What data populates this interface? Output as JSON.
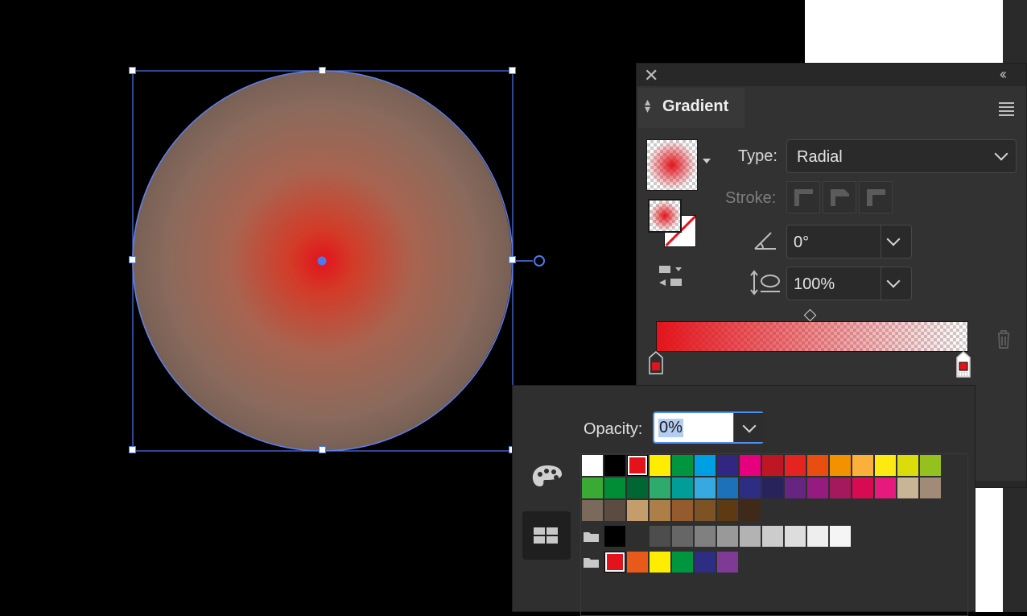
{
  "panel": {
    "title": "Gradient",
    "type_label": "Type:",
    "type_value": "Radial",
    "stroke_label": "Stroke:",
    "angle_value": "0°",
    "aspect_value": "100%"
  },
  "popup": {
    "opacity_label": "Opacity:",
    "opacity_value": "0%"
  },
  "colors": {
    "accent": "#4d78f0",
    "gradient_start": "#e3131b",
    "selection": "#5a82f5"
  },
  "icons": [
    "close-icon",
    "collapse-icon",
    "panel-menu-icon",
    "swatch-libraries-icon",
    "swatches-grid-icon",
    "trash-icon",
    "angle-icon",
    "aspect-ratio-icon",
    "folder-icon"
  ],
  "swatches": {
    "row1": [
      "#ffffff",
      "#000000",
      "#e3131b",
      "#ffed00",
      "#009640",
      "#009fe3",
      "#312783",
      "#e6007e",
      "#be1622",
      "#e52421",
      "#e84e0f",
      "#f39200",
      "#fbb03b",
      "#fcea10",
      "#dadc0b",
      "#95c11f"
    ],
    "row2": [
      "#3aaa35",
      "#008d36",
      "#006633",
      "#2eab6c",
      "#009e96",
      "#36a9e1",
      "#1d71b8",
      "#2d2e83",
      "#29235c",
      "#662483",
      "#951b81",
      "#a3195b",
      "#d60b52",
      "#e6197c",
      "#c8b596",
      "#a08a78"
    ],
    "row3": [
      "#7b6a5b",
      "#5c4b40",
      "#c59c6c",
      "#ad7e48",
      "#945c2e",
      "#7d5225",
      "#5e3a13",
      "#3f2a1a"
    ],
    "grays": [
      "#000000",
      "#2e2e2e",
      "#4d4d4d",
      "#666666",
      "#808080",
      "#999999",
      "#b3b3b3",
      "#cccccc",
      "#dddddd",
      "#eeeeee",
      "#f5f5f5"
    ],
    "group2": [
      "#e3131b",
      "#e8591a",
      "#ffed00",
      "#009640",
      "#2d2e83",
      "#7e3a95"
    ]
  }
}
